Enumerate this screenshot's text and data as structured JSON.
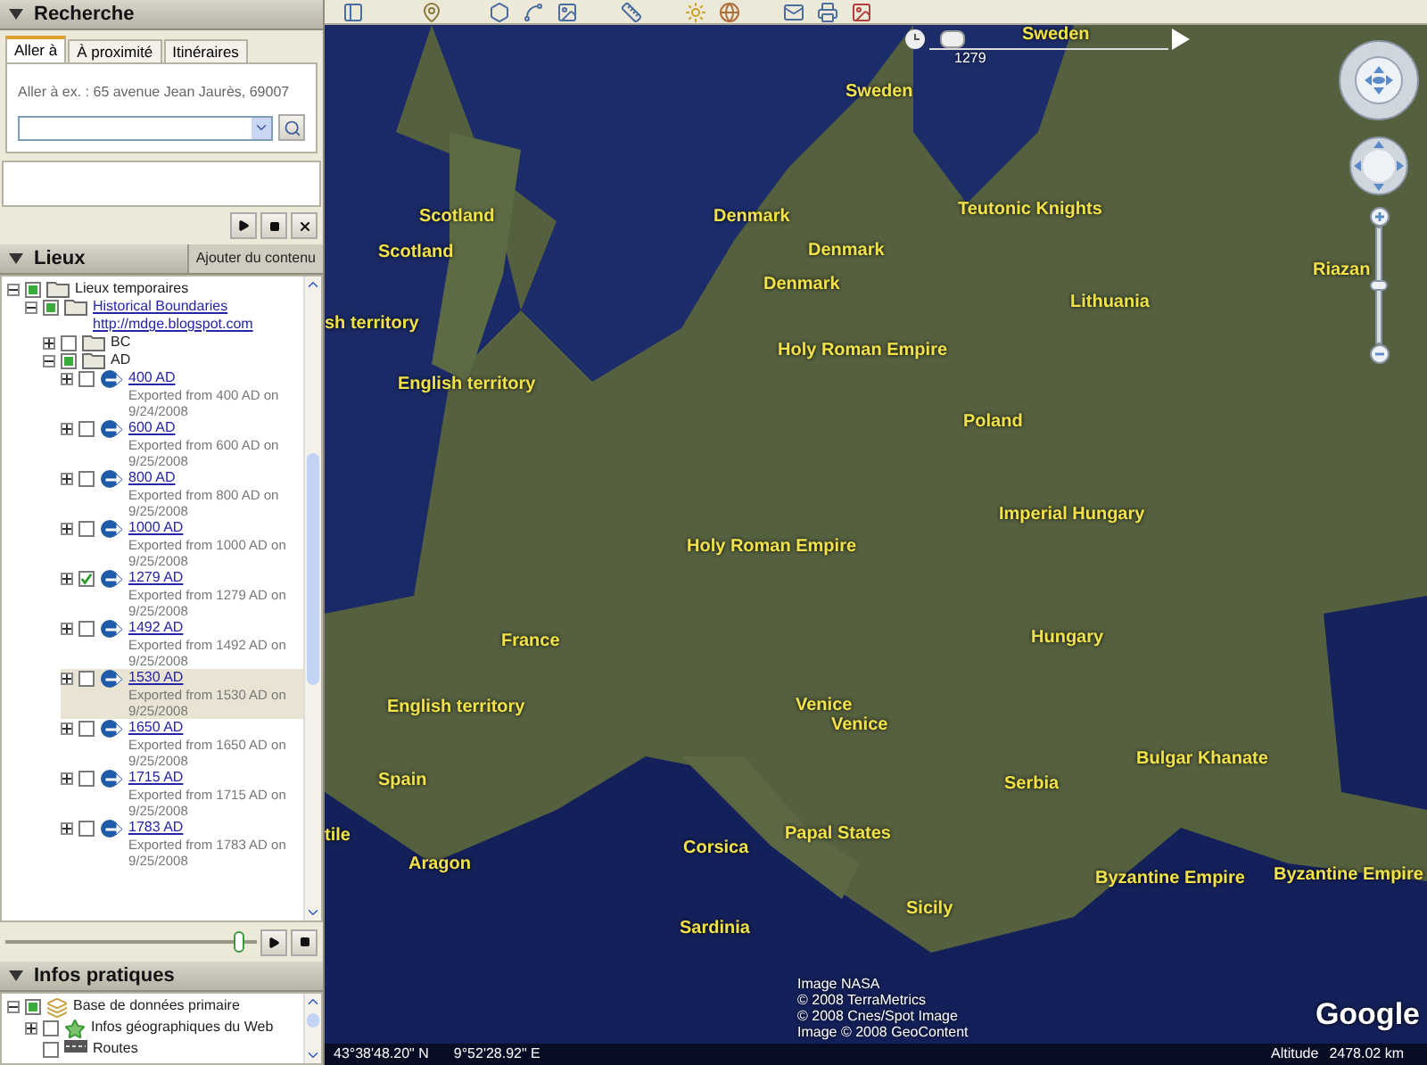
{
  "search_panel": {
    "title": "Recherche",
    "expanded": true,
    "tabs": [
      {
        "label": "Aller à",
        "selected": true
      },
      {
        "label": "À proximité",
        "selected": false
      },
      {
        "label": "Itinéraires",
        "selected": false
      }
    ],
    "hint": "Aller à ex. : 65 avenue Jean Jaurès, 69007"
  },
  "places_panel": {
    "title": "Lieux",
    "expanded": true,
    "add_button": "Ajouter du contenu",
    "tree": [
      {
        "kind": "folder",
        "label": "Lieux temporaires",
        "link": false,
        "checked": false,
        "partial": true,
        "expanded": true,
        "selected": false,
        "children": [
          {
            "kind": "folder",
            "label": "Historical Boundaries",
            "sublabel": "http://mdge.blogspot.com",
            "link": true,
            "checked": false,
            "partial": true,
            "expanded": true,
            "selected": false,
            "children": [
              {
                "kind": "folder",
                "label": "BC",
                "link": false,
                "checked": false,
                "partial": false,
                "expanded": false,
                "selected": false
              },
              {
                "kind": "folder",
                "label": "AD",
                "link": false,
                "checked": false,
                "partial": true,
                "expanded": true,
                "selected": false,
                "children": [
                  {
                    "kind": "network",
                    "label": "400 AD",
                    "description": "Exported from 400 AD on 9/24/2008",
                    "link": true,
                    "checked": false,
                    "partial": false,
                    "expanded": false,
                    "selected": false
                  },
                  {
                    "kind": "network",
                    "label": "600 AD",
                    "description": "Exported from 600 AD on 9/25/2008",
                    "link": true,
                    "checked": false,
                    "partial": false,
                    "expanded": false,
                    "selected": false
                  },
                  {
                    "kind": "network",
                    "label": "800 AD",
                    "description": "Exported from 800 AD on 9/25/2008",
                    "link": true,
                    "checked": false,
                    "partial": false,
                    "expanded": false,
                    "selected": false
                  },
                  {
                    "kind": "network",
                    "label": "1000 AD",
                    "description": "Exported from 1000 AD on 9/25/2008",
                    "link": true,
                    "checked": false,
                    "partial": false,
                    "expanded": false,
                    "selected": false
                  },
                  {
                    "kind": "network",
                    "label": "1279 AD",
                    "description": "Exported from 1279 AD on 9/25/2008",
                    "link": true,
                    "checked": true,
                    "partial": false,
                    "expanded": false,
                    "selected": false
                  },
                  {
                    "kind": "network",
                    "label": "1492 AD",
                    "description": "Exported from 1492 AD on 9/25/2008",
                    "link": true,
                    "checked": false,
                    "partial": false,
                    "expanded": false,
                    "selected": false
                  },
                  {
                    "kind": "network",
                    "label": "1530 AD",
                    "description": "Exported from 1530 AD on 9/25/2008",
                    "link": true,
                    "checked": false,
                    "partial": false,
                    "expanded": false,
                    "selected": true
                  },
                  {
                    "kind": "network",
                    "label": "1650 AD",
                    "description": "Exported from 1650 AD on 9/25/2008",
                    "link": true,
                    "checked": false,
                    "partial": false,
                    "expanded": false,
                    "selected": false
                  },
                  {
                    "kind": "network",
                    "label": "1715 AD",
                    "description": "Exported from 1715 AD on 9/25/2008",
                    "link": true,
                    "checked": false,
                    "partial": false,
                    "expanded": false,
                    "selected": false
                  },
                  {
                    "kind": "network",
                    "label": "1783 AD",
                    "description": "Exported from 1783 AD on 9/25/2008",
                    "link": true,
                    "checked": false,
                    "partial": false,
                    "expanded": false,
                    "selected": false
                  }
                ]
              }
            ]
          }
        ]
      }
    ],
    "tour_slider": {
      "level": 0.95
    }
  },
  "layers_panel": {
    "title": "Infos pratiques",
    "expanded": true,
    "tree": [
      {
        "kind": "database",
        "label": "Base de données primaire",
        "link": false,
        "checked": false,
        "partial": true,
        "expanded": true,
        "selected": false,
        "children": [
          {
            "kind": "star",
            "label": "Infos géographiques du Web",
            "link": false,
            "checked": false,
            "partial": false,
            "expanded": false,
            "selected": false
          },
          {
            "kind": "road",
            "label": "Routes",
            "link": false,
            "checked": false,
            "partial": false,
            "selected": false
          }
        ]
      }
    ]
  },
  "map": {
    "time_slider": {
      "level": 0.05,
      "reading": "1279"
    },
    "zoom_slider": {
      "level": 0.5
    },
    "labels": [
      "Sweden",
      "Sweden",
      "Scotland",
      "Denmark",
      "Teutonic Knights",
      "Riazan",
      "Scotland",
      "Denmark",
      "Denmark",
      "Lithuania",
      "sh territory",
      "English territory",
      "Holy Roman Empire",
      "Poland",
      "Imperial Hungary",
      "Holy Roman Empire",
      "France",
      "Hungary",
      "English territory",
      "Venice",
      "Venice",
      "Spain",
      "Serbia",
      "Bulgar Khanate",
      "tile",
      "Aragon",
      "Papal States",
      "Corsica",
      "Sicily",
      "Byzantine Empire",
      "Byzantine Empire",
      "Sardinia"
    ],
    "attribution": [
      "Image NASA",
      "© 2008 TerraMetrics",
      "© 2008 Cnes/Spot Image",
      "Image © 2008 GeoContent"
    ],
    "logo": "Google"
  },
  "status_bar": {
    "latitude": "43°38'48.20\" N",
    "longitude": "9°52'28.92\" E",
    "altitude_label": "Altitude",
    "altitude": "2478.02 km"
  }
}
